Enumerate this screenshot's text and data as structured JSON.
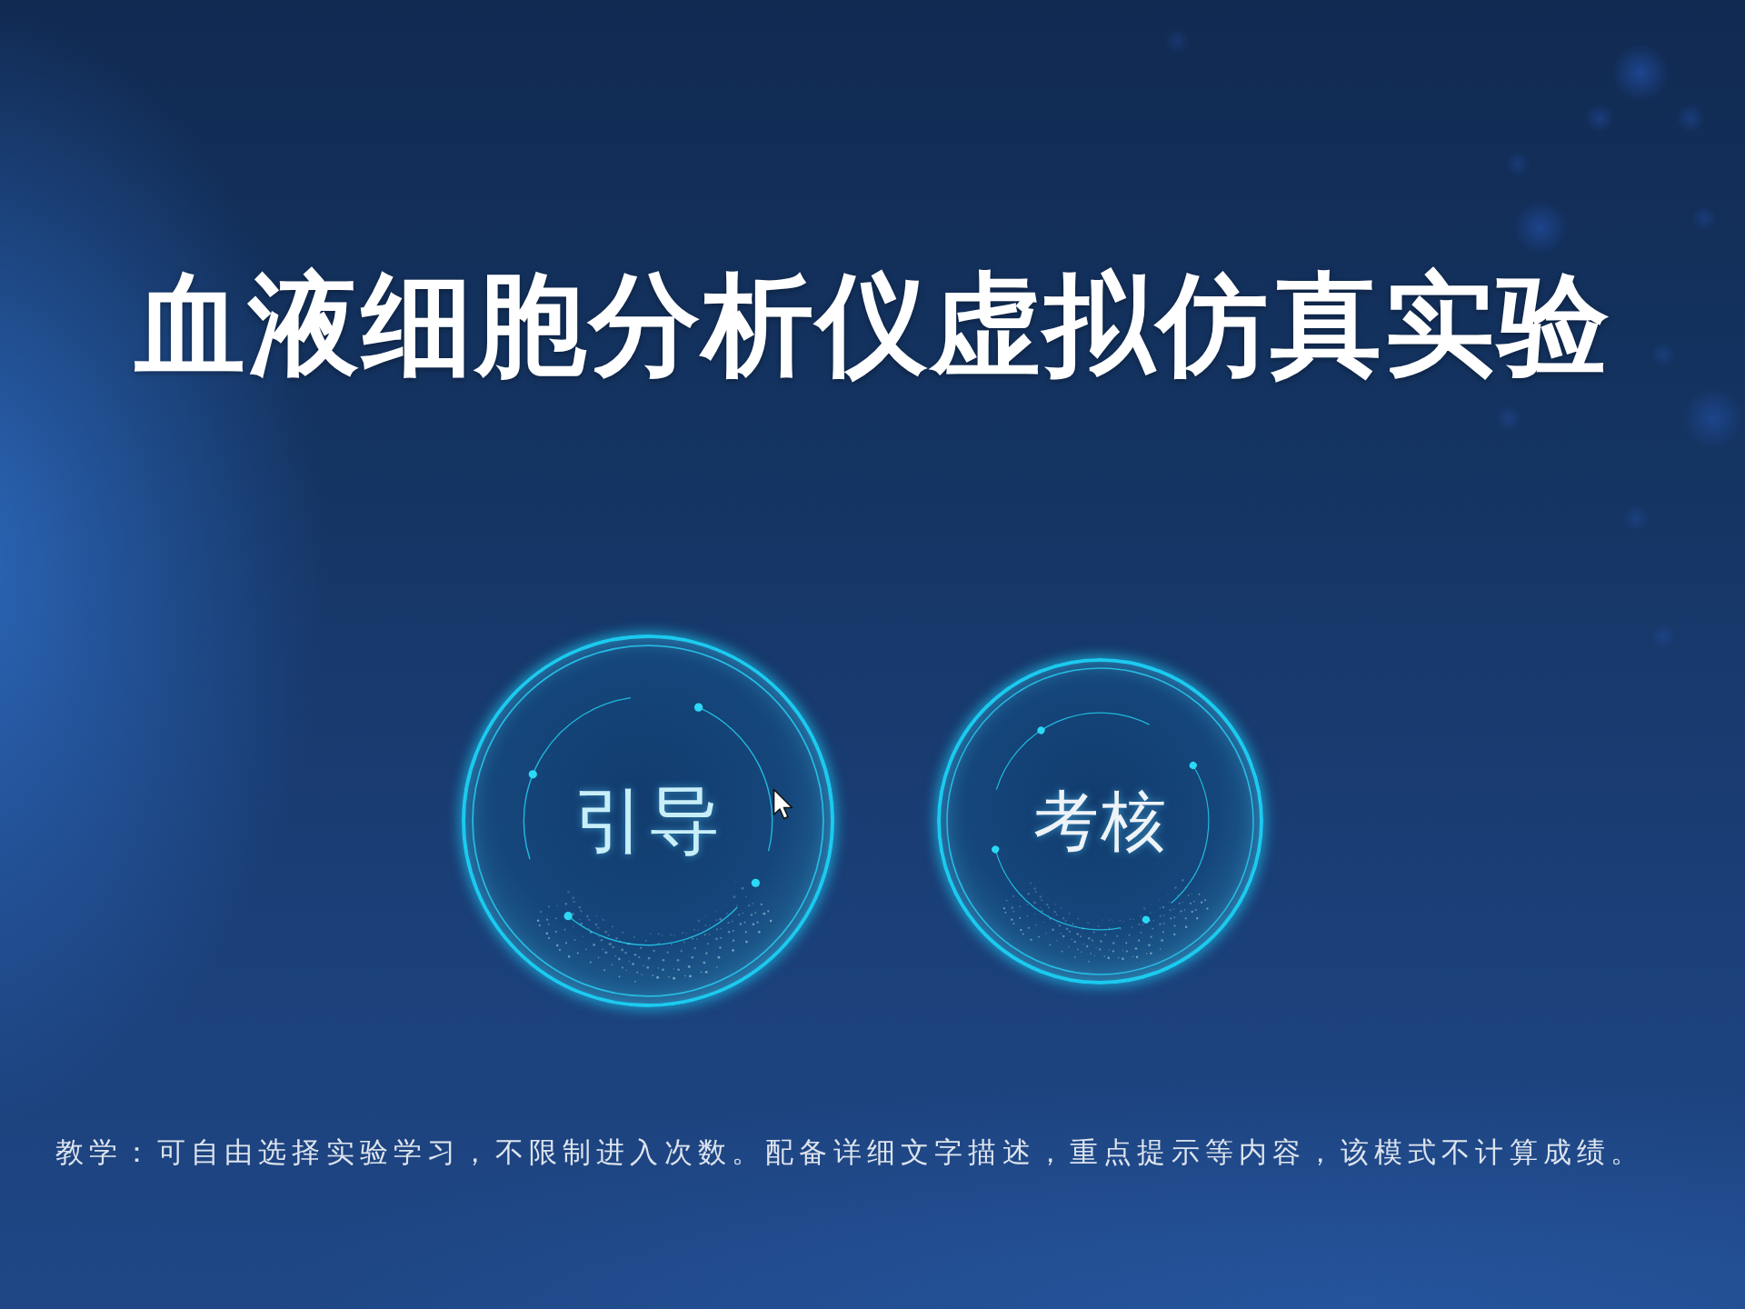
{
  "title": "血液细胞分析仪虚拟仿真实验",
  "modes": [
    {
      "label": "引导",
      "hovered": true
    },
    {
      "label": "考核",
      "hovered": false
    }
  ],
  "description": "教学：可自由选择实验学习，不限制进入次数。配备详细文字描述，重点提示等内容，该模式不计算成绩。"
}
